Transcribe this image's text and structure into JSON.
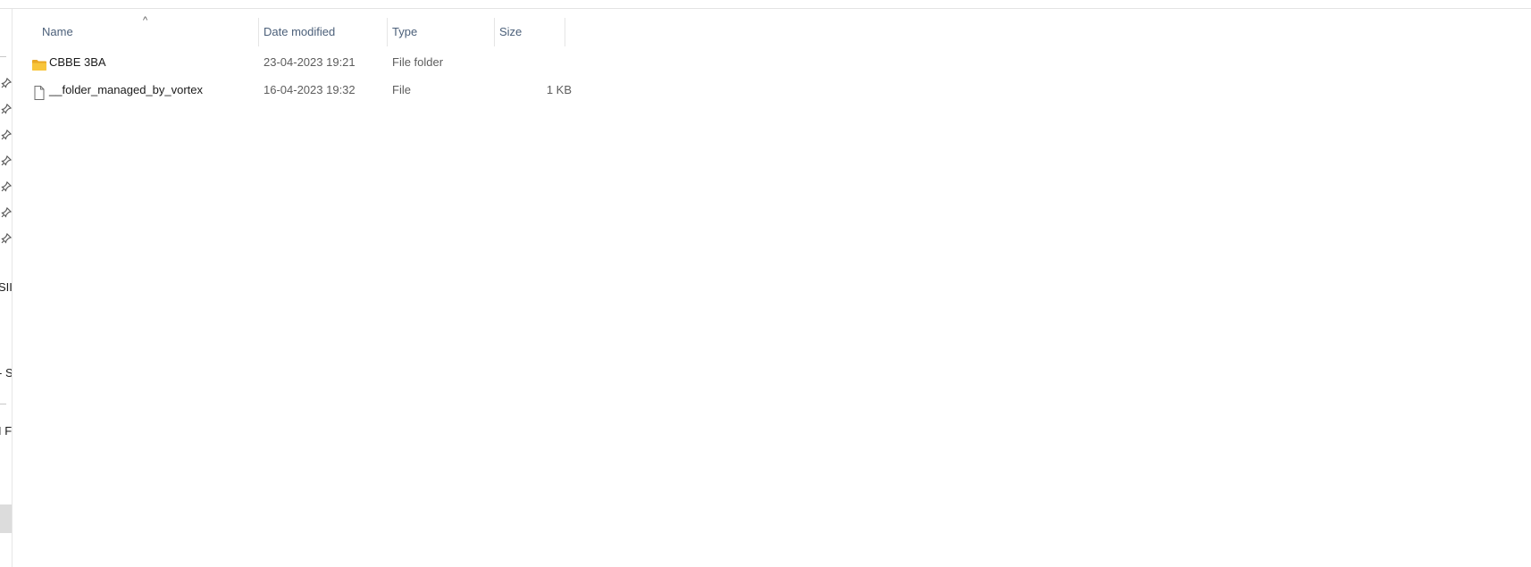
{
  "columns": {
    "name": "Name",
    "date_modified": "Date modified",
    "type": "Type",
    "size": "Size"
  },
  "files": [
    {
      "name": "CBBE 3BA",
      "date_modified": "23-04-2023 19:21",
      "type": "File folder",
      "size": "",
      "icon": "folder-icon"
    },
    {
      "name": "__folder_managed_by_vortex",
      "date_modified": "16-04-2023 19:32",
      "type": "File",
      "size": "1 KB",
      "icon": "file-icon"
    }
  ],
  "nav_pane": {
    "partial_labels": [
      "SII",
      "- S",
      "I F"
    ]
  },
  "colors": {
    "header_text": "#4c607a",
    "folder_yellow": "#f8c53a",
    "secondary_text": "#5d5d5d"
  }
}
